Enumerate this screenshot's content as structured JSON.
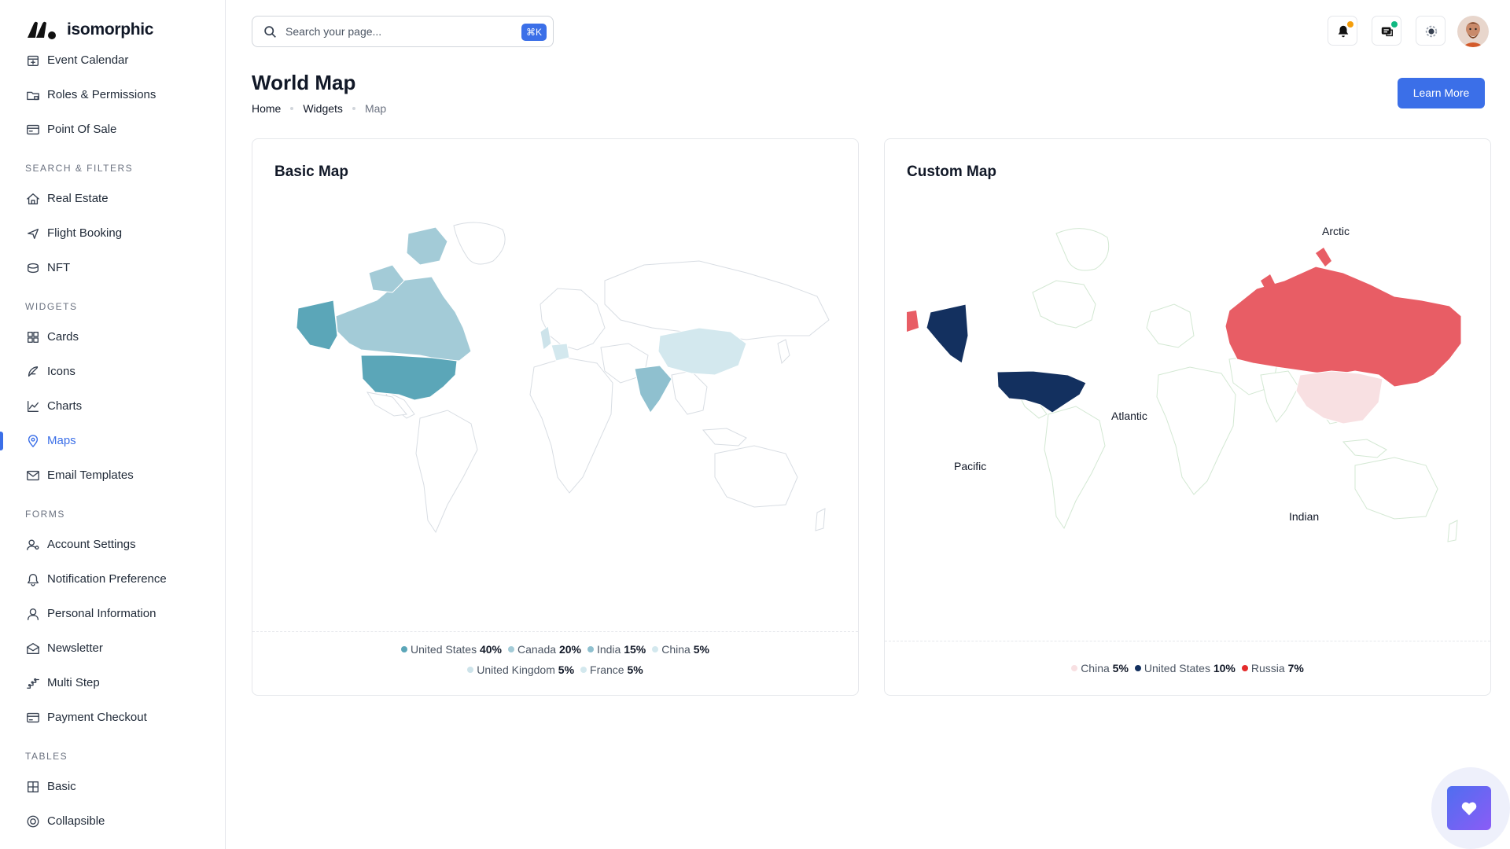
{
  "app": {
    "name": "isomorphic"
  },
  "sidebar": {
    "items_top": [
      {
        "label": "Event Calendar",
        "icon": "calendar-icon"
      },
      {
        "label": "Roles & Permissions",
        "icon": "folder-lock-icon"
      },
      {
        "label": "Point Of Sale",
        "icon": "pos-icon"
      }
    ],
    "sections": [
      {
        "title": "SEARCH & FILTERS",
        "items": [
          {
            "label": "Real Estate",
            "icon": "house-icon"
          },
          {
            "label": "Flight Booking",
            "icon": "plane-icon"
          },
          {
            "label": "NFT",
            "icon": "coins-icon"
          }
        ]
      },
      {
        "title": "WIDGETS",
        "items": [
          {
            "label": "Cards",
            "icon": "grid-icon"
          },
          {
            "label": "Icons",
            "icon": "feather-icon"
          },
          {
            "label": "Charts",
            "icon": "chart-icon"
          },
          {
            "label": "Maps",
            "icon": "map-pin-icon",
            "active": true
          },
          {
            "label": "Email Templates",
            "icon": "mail-icon"
          }
        ]
      },
      {
        "title": "FORMS",
        "items": [
          {
            "label": "Account Settings",
            "icon": "user-gear-icon"
          },
          {
            "label": "Notification Preference",
            "icon": "bell-icon"
          },
          {
            "label": "Personal Information",
            "icon": "user-icon"
          },
          {
            "label": "Newsletter",
            "icon": "envelope-open-icon"
          },
          {
            "label": "Multi Step",
            "icon": "steps-icon"
          },
          {
            "label": "Payment Checkout",
            "icon": "card-icon"
          }
        ]
      },
      {
        "title": "TABLES",
        "items": [
          {
            "label": "Basic",
            "icon": "table-icon"
          },
          {
            "label": "Collapsible",
            "icon": "collapse-icon"
          }
        ]
      }
    ]
  },
  "header": {
    "search_placeholder": "Search your page...",
    "shortcut": "⌘K",
    "icons": [
      "bell-icon",
      "messages-icon",
      "settings-icon"
    ],
    "notification_dot_color": "#f59e0b",
    "message_dot_color": "#10b981"
  },
  "page": {
    "title": "World Map",
    "breadcrumbs": [
      "Home",
      "Widgets",
      "Map"
    ],
    "learn_more": "Learn More"
  },
  "colors": {
    "accent": "#3b6fe8"
  },
  "basic_map": {
    "title": "Basic Map",
    "legend": [
      {
        "name": "United States",
        "value": "40%",
        "color": "#5ba6b8"
      },
      {
        "name": "Canada",
        "value": "20%",
        "color": "#a3cbd7"
      },
      {
        "name": "India",
        "value": "15%",
        "color": "#8fc0cf"
      },
      {
        "name": "China",
        "value": "5%",
        "color": "#d3e8ee"
      },
      {
        "name": "United Kingdom",
        "value": "5%",
        "color": "#cde3ea"
      },
      {
        "name": "France",
        "value": "5%",
        "color": "#d3e8ee"
      }
    ]
  },
  "custom_map": {
    "title": "Custom Map",
    "oceans": [
      "Arctic",
      "Atlantic",
      "Pacific",
      "Indian"
    ],
    "legend": [
      {
        "name": "China",
        "value": "5%",
        "color": "#f8e0e2"
      },
      {
        "name": "United States",
        "value": "10%",
        "color": "#13305f"
      },
      {
        "name": "Russia",
        "value": "7%",
        "color": "#e42b2b"
      }
    ]
  }
}
